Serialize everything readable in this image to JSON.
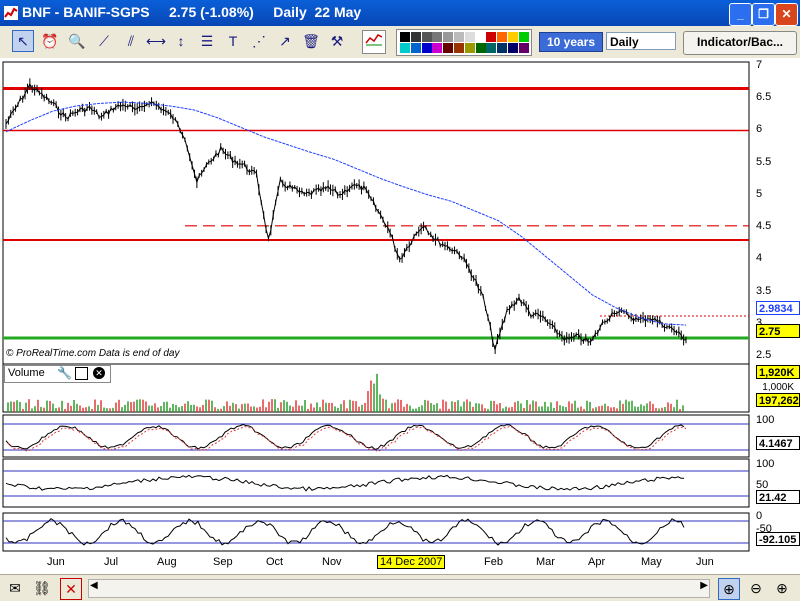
{
  "window": {
    "title": "BNF - BANIF-SGPS     2.75 (-1.08%)     Daily  22 May",
    "controls": [
      "minimize",
      "restore",
      "close"
    ]
  },
  "toolbar": {
    "period_label": "10 years",
    "frequency_label": "Daily",
    "indicator_label": "Indicator/Bac...",
    "tools": [
      "pointer-icon",
      "alarm-icon",
      "zoom-icon",
      "trendline-icon",
      "channel-icon",
      "horizontal-line-icon",
      "vertical-line-icon",
      "fibonacci-icon",
      "text-icon",
      "fan-icon",
      "arrow-icon",
      "trash-icon",
      "properties-icon",
      "chart-style-icon"
    ]
  },
  "colors": {
    "price_line": "#000000",
    "moving_average": "#1f3fff",
    "resistance": "#e00000",
    "support": "#22aa22",
    "volume_up": "#2c9e2c",
    "volume_down": "#e03a3a"
  },
  "price_panel": {
    "copyright": "© ProRealTime.com  Data is end of day",
    "y_ticks": [
      "7",
      "6.5",
      "6",
      "5.5",
      "5",
      "4.5",
      "4",
      "3.5",
      "3",
      "2.5"
    ],
    "current_price_label": "2.75",
    "ma_label": "2.9834"
  },
  "volume_panel": {
    "label": "Volume",
    "value_top": "1,920K",
    "value_mid": "1,000K",
    "value_bottom": "197,262"
  },
  "indicator1": {
    "tick_top": "100",
    "value": "4.1467"
  },
  "indicator2": {
    "tick_top": "100",
    "tick_mid": "50",
    "value": "21.42"
  },
  "indicator3": {
    "tick_top": "0",
    "tick_mid": "-50",
    "value": "-92.105"
  },
  "x_axis": {
    "months": [
      "Jun",
      "Jul",
      "Aug",
      "Sep",
      "Oct",
      "Nov",
      "Feb",
      "Mar",
      "Apr",
      "May",
      "Jun"
    ],
    "cursor_label": "14 Dec 2007"
  },
  "chart_data": {
    "type": "line",
    "title": "BNF - BANIF-SGPS",
    "x_range": [
      "May 2007",
      "May 2008"
    ],
    "ylim": [
      2.5,
      7
    ],
    "series": [
      {
        "values": [
          6.1,
          6.4,
          6.7,
          6.55,
          6.4,
          6.2,
          6.3,
          6.35,
          6.2,
          6.35,
          6.4,
          6.3,
          6.45,
          6.35,
          6.2,
          5.9,
          5.2,
          5.5,
          5.7,
          5.55,
          5.45,
          5.3,
          4.3,
          5.2,
          5.1,
          5.0,
          5.05,
          5.1,
          5.0,
          5.15,
          5.1,
          4.8,
          4.5,
          4.0,
          4.3,
          4.55,
          4.3,
          4.2,
          4.1,
          3.8,
          3.4,
          2.6,
          3.2,
          3.4,
          3.15,
          3.1,
          2.9,
          2.75,
          2.8,
          2.7,
          3.0,
          3.2,
          3.15,
          3.05,
          3.1,
          3.0,
          2.9,
          2.75
        ]
      },
      {
        "values": [
          5.98,
          6.15,
          6.3,
          6.38,
          6.42,
          6.44,
          6.42,
          6.38,
          6.32,
          6.2,
          6.05,
          5.9,
          5.78,
          5.66,
          5.55,
          5.4,
          5.25,
          5.12,
          5.0,
          4.9,
          4.75,
          4.6,
          4.35,
          4.05,
          3.75,
          3.45,
          3.25,
          3.1,
          3.0,
          2.98
        ]
      }
    ],
    "reference_lines": [
      6.65,
      6.0,
      4.52,
      4.3,
      2.78
    ]
  }
}
